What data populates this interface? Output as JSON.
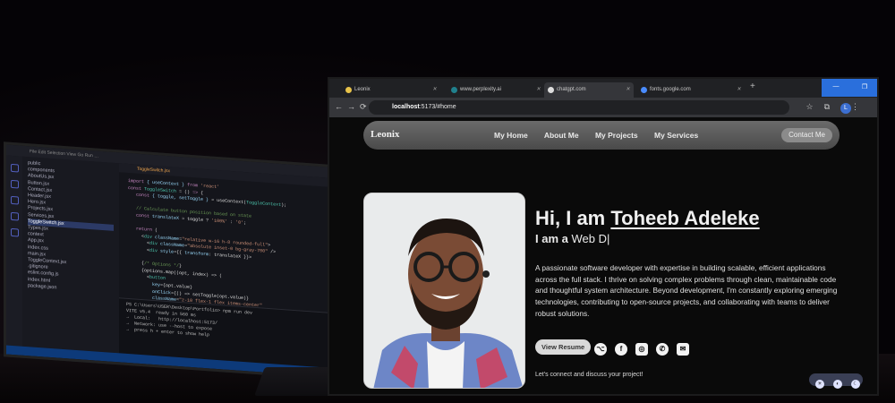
{
  "laptop": {
    "explorer_items": [
      "public",
      "components",
      "AboutUs.jsx",
      "Button.jsx",
      "Contact.jsx",
      "Header.jsx",
      "Hero.jsx",
      "Projects.jsx",
      "Services.jsx",
      "ToggleSwitch.jsx",
      "Types.jsx",
      "context",
      "App.jsx",
      "index.css",
      "main.jsx",
      "ToggleContext.jsx",
      ".gitignore",
      "eslint.config.js",
      "index.html",
      "package.json"
    ],
    "editor_tab": "ToggleSwitch.jsx",
    "terminal_lines": [
      "PS C:\\Users\\USER\\Desktop\\Portfolio> npm run dev",
      "VITE v5.4  ready in 560 ms",
      "→  Local:   http://localhost:5173/",
      "→  Network: use --host to expose",
      "→  press h + enter to show help"
    ]
  },
  "browser": {
    "tabs": [
      {
        "label": "Leonix"
      },
      {
        "label": "www.perplexity.ai"
      },
      {
        "label": "chatgpt.com"
      },
      {
        "label": "fonts.google.com"
      }
    ],
    "url_host": "localhost",
    "url_rest": ":5173/#home",
    "profile_initial": "L"
  },
  "site": {
    "logo": "Leonix",
    "nav": [
      "My Home",
      "About Me",
      "My Projects",
      "My Services"
    ],
    "contact_button": "Contact Me",
    "greeting": "Hi, I am",
    "name": "Toheeb Adeleke",
    "sub_prefix": "I am a",
    "sub_typed": "Web D|",
    "description": "A passionate software developer with expertise in building scalable, efficient applications across the full stack. I thrive on solving complex problems through clean, maintainable code and thoughtful system architecture. Beyond development, I'm constantly exploring emerging technologies, contributing to open-source projects, and collaborating with teams to deliver robust solutions.",
    "resume_button": "View Resume",
    "social_icons": [
      "github-icon",
      "facebook-icon",
      "instagram-icon",
      "whatsapp-icon",
      "email-icon"
    ],
    "connect_text": "Let's connect and discuss your project!"
  },
  "colors": {
    "navbar": "#5a5a5a",
    "page_bg": "#0a0a0a",
    "accent_blue": "#2a6fdc"
  }
}
